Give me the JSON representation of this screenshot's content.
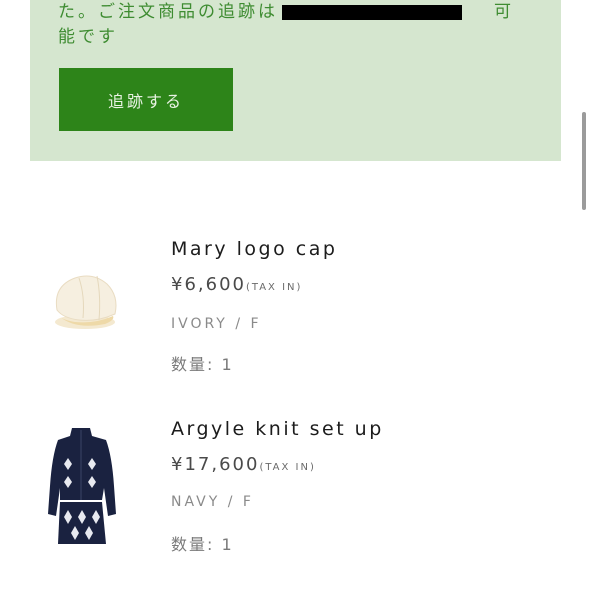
{
  "notice": {
    "line1_prefix": "た。ご注文商品の追跡は",
    "line1_suffix": "可",
    "line2": "能です"
  },
  "track_button": {
    "label": "追跡する",
    "color": "#2d8419"
  },
  "items": [
    {
      "name": "Mary logo cap",
      "price": "¥6,600",
      "tax": "(TAX IN)",
      "variant": "IVORY / F",
      "qty": "数量: 1",
      "image": "cap-thumbnail"
    },
    {
      "name": "Argyle knit set up",
      "price": "¥17,600",
      "tax": "(TAX IN)",
      "variant": "NAVY / F",
      "qty": "数量: 1",
      "image": "knit-setup-thumbnail"
    }
  ],
  "colors": {
    "notice_bg": "#d5e6cf",
    "notice_text": "#3e8c31"
  }
}
